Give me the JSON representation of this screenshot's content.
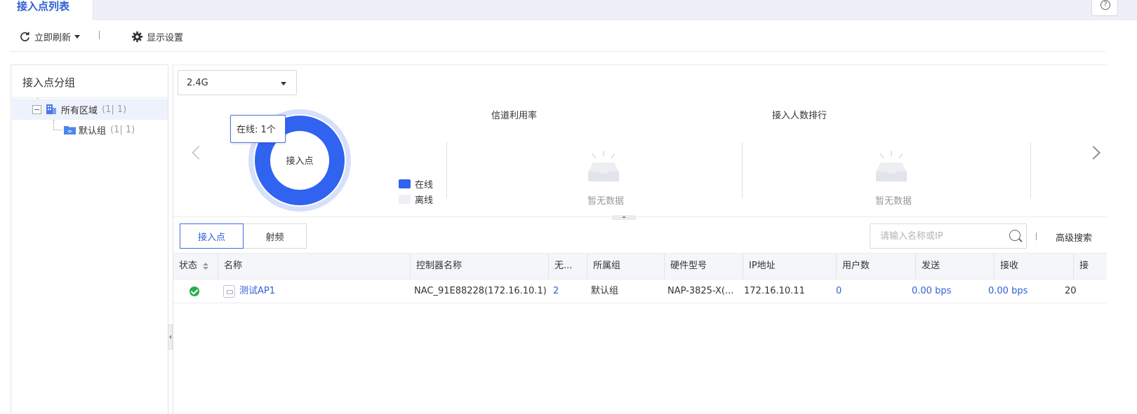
{
  "tabs": [
    {
      "label": "接入点列表",
      "active": true
    }
  ],
  "help": {
    "icon": "help-icon",
    "glyph": "?"
  },
  "toolbar": {
    "refresh_label": "立即刷新",
    "settings_label": "显示设置"
  },
  "group_panel": {
    "title": "接入点分组",
    "tree": [
      {
        "label": "所有区域",
        "count": "(1| 1)",
        "selected": true,
        "icon": "building-icon"
      },
      {
        "label": "默认组",
        "count": "(1| 1)",
        "selected": false,
        "icon": "folder-icon"
      }
    ]
  },
  "stats": {
    "band_select": "2.4G",
    "donut": {
      "center_label": "接入点",
      "tooltip": "在线: 1个",
      "online": 1,
      "offline": 0
    },
    "legend": [
      {
        "label": "在线",
        "color": "#2f63f0"
      },
      {
        "label": "离线",
        "color": "#eef0f5"
      }
    ],
    "channel_title": "信道利用率",
    "ranking_title": "接入人数排行",
    "empty_text": "暂无数据"
  },
  "segments": [
    {
      "label": "接入点",
      "active": true
    },
    {
      "label": "射频",
      "active": false
    }
  ],
  "search": {
    "placeholder": "请输入名称或IP",
    "advanced_label": "高级搜索"
  },
  "table": {
    "headers": [
      "状态",
      "名称",
      "控制器名称",
      "无...",
      "所属组",
      "硬件型号",
      "IP地址",
      "用户数",
      "发送",
      "接收",
      "接"
    ],
    "rows": [
      {
        "status": "online",
        "name": "测试AP1",
        "controller": "NAC_91E88228(172.16.10.1)",
        "wireless": "2",
        "group": "默认组",
        "model": "NAP-3825-X(...",
        "ip": "172.16.10.11",
        "users": "0",
        "tx": "0.00 bps",
        "rx": "0.00 bps",
        "last": "20"
      }
    ]
  },
  "colors": {
    "accent": "#2f5fd6",
    "online": "#2f63f0",
    "donut_outer": "#d6e0fb",
    "status_ok": "#22b14c"
  }
}
